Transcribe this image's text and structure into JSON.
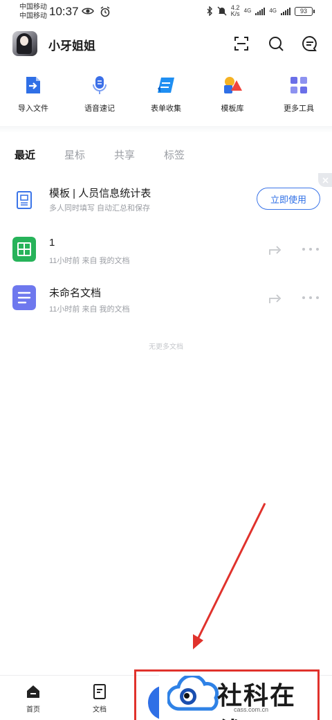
{
  "status_bar": {
    "carrier1": "中国移动",
    "carrier2": "中国移动",
    "time": "10:37",
    "speed_value": "4.2",
    "speed_unit": "K/s",
    "net1": "4G",
    "net2": "4G",
    "battery": "93"
  },
  "header": {
    "username": "小牙姐姐"
  },
  "tools": [
    {
      "label": "导入文件",
      "icon": "import-file-icon",
      "color": "#2f6fe6"
    },
    {
      "label": "语音速记",
      "icon": "microphone-icon",
      "color": "#3b6fe8"
    },
    {
      "label": "表单收集",
      "icon": "form-collect-icon",
      "color": "#1f8ff2"
    },
    {
      "label": "模板库",
      "icon": "template-library-icon",
      "color": "#f5a623"
    },
    {
      "label": "更多工具",
      "icon": "more-tools-icon",
      "color": "#6a6fe8"
    }
  ],
  "tabs": [
    {
      "label": "最近",
      "active": true
    },
    {
      "label": "星标",
      "active": false
    },
    {
      "label": "共享",
      "active": false
    },
    {
      "label": "标签",
      "active": false
    }
  ],
  "recommend": {
    "title": "模板 | 人员信息统计表",
    "subtitle": "多人同时填写 自动汇总和保存",
    "button": "立即使用"
  },
  "files": [
    {
      "name": "1",
      "meta": "11小时前  来自 我的文档",
      "type": "spreadsheet",
      "color": "#27b35a"
    },
    {
      "name": "未命名文档",
      "meta": "11小时前  来自 我的文档",
      "type": "document",
      "color": "#6e78ee"
    }
  ],
  "no_more": "无更多文档",
  "nav": {
    "home": "首页",
    "docs": "文档"
  },
  "watermark": {
    "text": "社科在线",
    "url": "cass.com.cn"
  },
  "colors": {
    "accent": "#2f6fe6",
    "annotation": "#e0322c"
  }
}
